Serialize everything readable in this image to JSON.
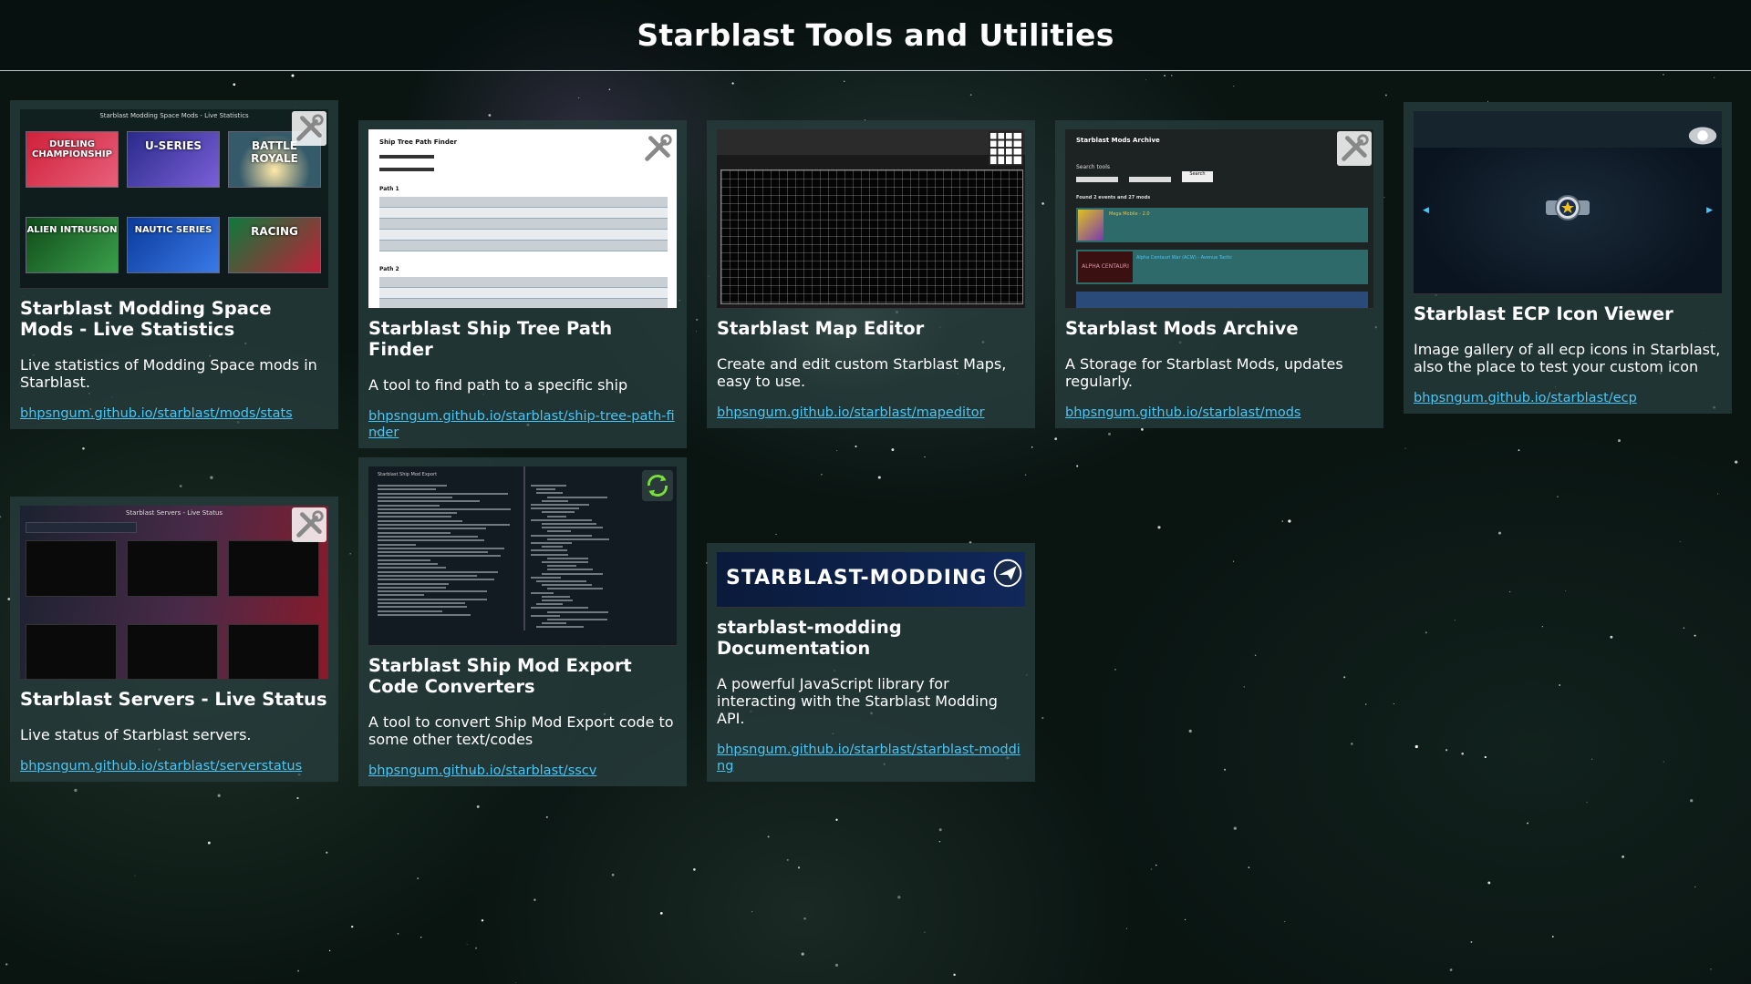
{
  "page": {
    "title": "Starblast Tools and Utilities"
  },
  "cards": [
    {
      "title": "Starblast Modding Space Mods - Live Statistics",
      "description": "Live statistics of Modding Space mods in Starblast.",
      "link": "bhpsngum.github.io/starblast/mods/stats",
      "corner_icon": "tools-icon",
      "thumb": {
        "heading": "Starblast Modding Space Mods - Live Statistics",
        "tiles": [
          "DUELING CHAMPIONSHIP",
          "U-SERIES",
          "BATTLE ROYALE",
          "ALIEN INTRUSION",
          "NAUTIC SERIES",
          "RACING"
        ]
      }
    },
    {
      "title": "Starblast Ship Tree Path Finder",
      "description": "A tool to find path to a specific ship",
      "link": "bhpsngum.github.io/starblast/ship-tree-path-finder",
      "corner_icon": "tools-icon",
      "thumb": {
        "heading": "Ship Tree Path Finder",
        "path1": "Path 1",
        "path2": "Path 2"
      }
    },
    {
      "title": "Starblast Map Editor",
      "description": "Create and edit custom Starblast Maps, easy to use.",
      "link": "bhpsngum.github.io/starblast/mapeditor",
      "corner_icon": "grid-icon"
    },
    {
      "title": "Starblast Mods Archive",
      "description": "A Storage for Starblast Mods, updates regularly.",
      "link": "bhpsngum.github.io/starblast/mods",
      "corner_icon": "tools-icon",
      "thumb": {
        "heading": "Starblast Mods Archive",
        "search_label": "Search tools",
        "search_button": "Search",
        "found": "Found 2 events and 27 mods",
        "item1": "Mega Mobile - 2.0",
        "item2": "Alpha Centauri War (ACW) - Avenue Tactic",
        "item2_badge": "ALPHA CENTAURI"
      }
    },
    {
      "title": "Starblast ECP Icon Viewer",
      "description": "Image gallery of all ecp icons in Starblast, also the place to test your custom icon",
      "link": "bhpsngum.github.io/starblast/ecp",
      "corner_icon": "badge-icon"
    },
    {
      "title": "Starblast Servers - Live Status",
      "description": "Live status of Starblast servers.",
      "link": "bhpsngum.github.io/starblast/serverstatus",
      "corner_icon": "tools-icon",
      "thumb": {
        "heading": "Starblast Servers - Live Status"
      }
    },
    {
      "title": "Starblast Ship Mod Export Code Converters",
      "description": "A tool to convert Ship Mod Export code to some other text/codes",
      "link": "bhpsngum.github.io/starblast/sscv",
      "corner_icon": "refresh-icon",
      "thumb": {
        "heading": "Starblast Ship Mod Export"
      }
    },
    {
      "title": "starblast-modding Documentation",
      "description": "A powerful JavaScript library for interacting with the Starblast Modding API.",
      "link": "bhpsngum.github.io/starblast/starblast-modding",
      "corner_icon": "ship-logo-icon",
      "thumb": {
        "banner": "STARBLAST-MODDING"
      }
    }
  ],
  "colors": {
    "card_bg": "#2a3f3f",
    "link": "#49c6f6",
    "page_bg": "#0a1512"
  }
}
